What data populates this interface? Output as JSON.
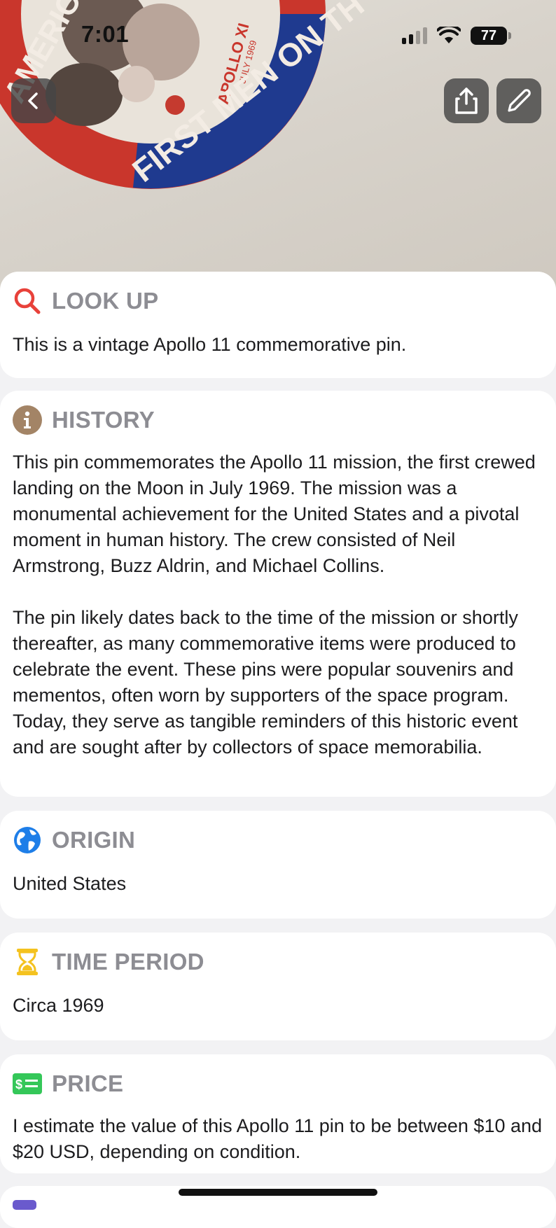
{
  "status_bar": {
    "time": "7:01",
    "battery": "77"
  },
  "hero": {
    "image_text_line1": "AMERICA S",
    "image_text_line2": "FIRST MEN ON TH",
    "image_text_line3": "APOLLO XI",
    "image_text_line4": "JULY 1969"
  },
  "cards": {
    "lookup": {
      "title": "LOOK UP",
      "icon": "search-icon",
      "body": "This is a vintage Apollo 11 commemorative pin."
    },
    "history": {
      "title": "HISTORY",
      "icon": "info-icon",
      "paragraph1": "This pin commemorates the Apollo 11 mission, the first crewed landing on the Moon in July 1969. The mission was a monumental achievement for the United States and a pivotal moment in human history. The crew consisted of Neil Armstrong, Buzz Aldrin, and Michael Collins.",
      "paragraph2": "The pin likely dates back to the time of the mission or shortly thereafter, as many commemorative items were produced to celebrate the event. These pins were popular souvenirs and mementos, often worn by supporters of the space program. Today, they serve as tangible reminders of this historic event and are sought after by collectors of space memorabilia."
    },
    "origin": {
      "title": "ORIGIN",
      "icon": "globe-icon",
      "body": "United States"
    },
    "time_period": {
      "title": "TIME PERIOD",
      "icon": "hourglass-icon",
      "body": "Circa 1969"
    },
    "price": {
      "title": "PRICE",
      "icon": "money-icon",
      "body": "I estimate the value of this Apollo 11 pin to be between $10 and $20 USD, depending on condition."
    }
  },
  "colors": {
    "search_red": "#e8413a",
    "info_brown": "#a38466",
    "globe_blue": "#1e7ee8",
    "hourglass_yellow": "#f4c21f",
    "money_green": "#34c759",
    "title_gray": "#8d8d93"
  }
}
